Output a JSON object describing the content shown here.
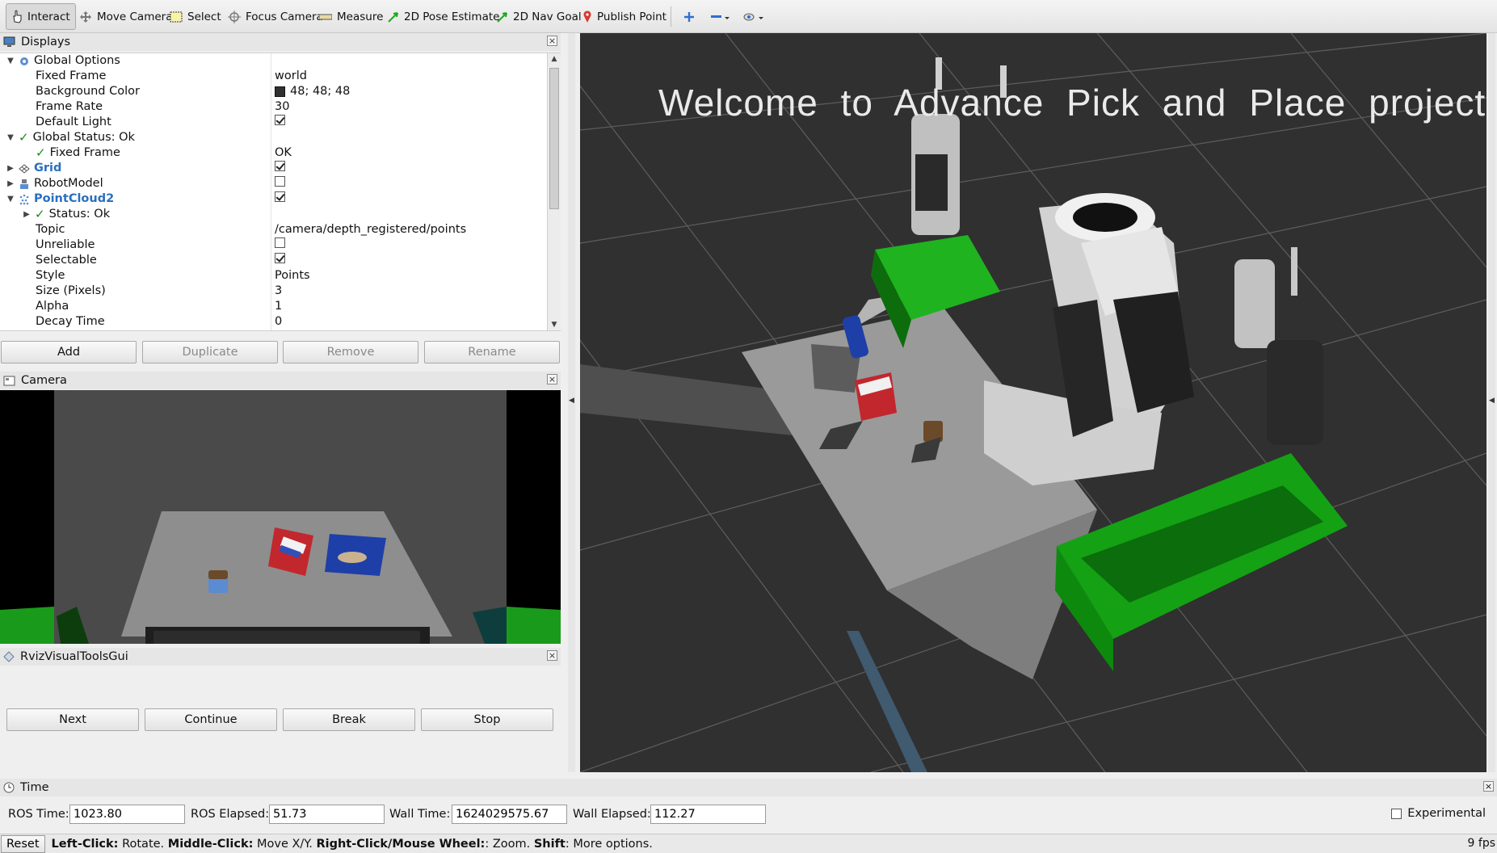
{
  "toolbar": {
    "interact": "Interact",
    "move_camera": "Move Camera",
    "select": "Select",
    "focus_camera": "Focus Camera",
    "measure": "Measure",
    "pose_estimate": "2D Pose Estimate",
    "nav_goal": "2D Nav Goal",
    "publish_point": "Publish Point"
  },
  "displays": {
    "title": "Displays",
    "rows": [
      {
        "label": "Global Options",
        "value": ""
      },
      {
        "label": "Fixed Frame",
        "value": "world"
      },
      {
        "label": "Background Color",
        "value": "48; 48; 48"
      },
      {
        "label": "Frame Rate",
        "value": "30"
      },
      {
        "label": "Default Light",
        "value": ""
      },
      {
        "label": "Global Status: Ok",
        "value": ""
      },
      {
        "label": "Fixed Frame",
        "value": "OK"
      },
      {
        "label": "Grid",
        "value": ""
      },
      {
        "label": "RobotModel",
        "value": ""
      },
      {
        "label": "PointCloud2",
        "value": ""
      },
      {
        "label": "Status: Ok",
        "value": ""
      },
      {
        "label": "Topic",
        "value": "/camera/depth_registered/points"
      },
      {
        "label": "Unreliable",
        "value": ""
      },
      {
        "label": "Selectable",
        "value": ""
      },
      {
        "label": "Style",
        "value": "Points"
      },
      {
        "label": "Size (Pixels)",
        "value": "3"
      },
      {
        "label": "Alpha",
        "value": "1"
      },
      {
        "label": "Decay Time",
        "value": "0"
      }
    ],
    "checks": {
      "default_light": true,
      "grid": true,
      "robot_model": false,
      "point_cloud": true,
      "unreliable": false,
      "selectable": true
    },
    "buttons": {
      "add": "Add",
      "duplicate": "Duplicate",
      "remove": "Remove",
      "rename": "Rename"
    }
  },
  "camera": {
    "title": "Camera"
  },
  "rviz_tools": {
    "title": "RvizVisualToolsGui",
    "buttons": {
      "next": "Next",
      "continue": "Continue",
      "break": "Break",
      "stop": "Stop"
    }
  },
  "view3d": {
    "overlay_text": "Welcome to Advance Pick and Place project",
    "background_color": "#303030"
  },
  "time": {
    "title": "Time",
    "ros_time_label": "ROS Time:",
    "ros_time": "1023.80",
    "ros_elapsed_label": "ROS Elapsed:",
    "ros_elapsed": "51.73",
    "wall_time_label": "Wall Time:",
    "wall_time": "1624029575.67",
    "wall_elapsed_label": "Wall Elapsed:",
    "wall_elapsed": "112.27",
    "experimental_label": "Experimental"
  },
  "status": {
    "reset": "Reset",
    "hint_1b": "Left-Click:",
    "hint_1": " Rotate. ",
    "hint_2b": "Middle-Click:",
    "hint_2": " Move X/Y. ",
    "hint_3b": "Right-Click/Mouse Wheel:",
    "hint_3": ": Zoom. ",
    "hint_4b": "Shift",
    "hint_4": ": More options.",
    "fps": "9 fps"
  }
}
